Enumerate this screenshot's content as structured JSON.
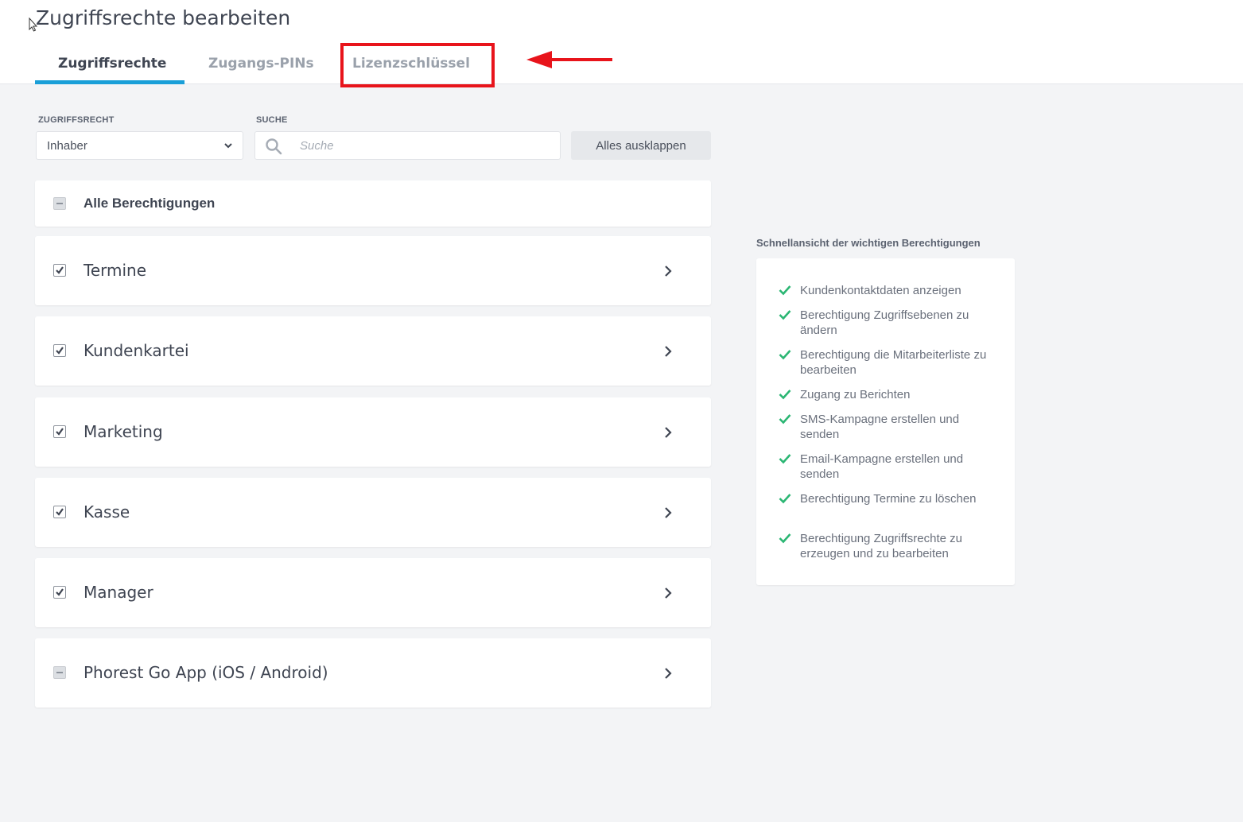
{
  "page": {
    "title": "Zugriffsrechte bearbeiten"
  },
  "tabs": [
    {
      "label": "Zugriffsrechte",
      "active": true
    },
    {
      "label": "Zugangs-PINs",
      "active": false
    },
    {
      "label": "Lizenzschlüssel",
      "active": false,
      "highlighted": true
    }
  ],
  "filters": {
    "role_label": "ZUGRIFFSRECHT",
    "role_value": "Inhaber",
    "search_label": "SUCHE",
    "search_placeholder": "Suche",
    "expand_all_label": "Alles ausklappen"
  },
  "permissions": {
    "all": {
      "label": "Alle Berechtigungen",
      "state": "partial"
    },
    "groups": [
      {
        "label": "Termine",
        "state": "checked"
      },
      {
        "label": "Kundenkartei",
        "state": "checked"
      },
      {
        "label": "Marketing",
        "state": "checked"
      },
      {
        "label": "Kasse",
        "state": "checked"
      },
      {
        "label": "Manager",
        "state": "checked"
      },
      {
        "label": "Phorest Go App (iOS / Android)",
        "state": "partial"
      }
    ]
  },
  "quick_view": {
    "title": "Schnellansicht der wichtigen Berechtigungen",
    "items": [
      "Kundenkontaktdaten anzeigen",
      "Berechtigung Zugriffsebenen zu ändern",
      "Berechtigung die Mitarbeiterliste zu bearbeiten",
      "Zugang zu Berichten",
      "SMS-Kampagne erstellen und senden",
      "Email-Kampagne erstellen und senden",
      "Berechtigung Termine zu löschen",
      "Berechtigung Zugriffsrechte zu erzeugen und zu bearbeiten"
    ]
  },
  "colors": {
    "accent": "#1a9fd8",
    "annotation": "#e8141b",
    "check": "#2bb673"
  },
  "icons": {
    "search": "search-icon",
    "dropdown": "chevron-down-icon",
    "row_expand": "chevron-right-icon",
    "quick_item": "check-icon"
  }
}
